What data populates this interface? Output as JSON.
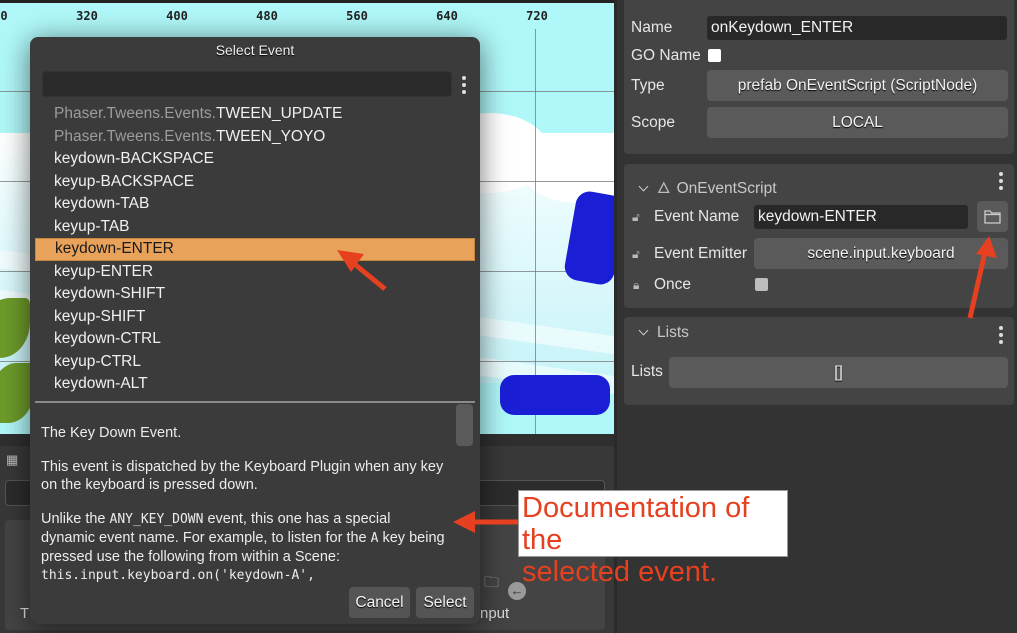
{
  "scene": {
    "ruler_ticks": [
      "0",
      "320",
      "400",
      "480",
      "560",
      "640",
      "720"
    ]
  },
  "bottom_panel": {
    "input_label": "nput",
    "t_label": "T"
  },
  "dialog": {
    "title": "Select Event",
    "filter_value": "",
    "events": [
      {
        "ns": "Phaser.Tweens.Events.",
        "name": "TWEEN_UPDATE",
        "selected": false
      },
      {
        "ns": "Phaser.Tweens.Events.",
        "name": "TWEEN_YOYO",
        "selected": false
      },
      {
        "ns": "",
        "name": "keydown-BACKSPACE",
        "selected": false
      },
      {
        "ns": "",
        "name": "keyup-BACKSPACE",
        "selected": false
      },
      {
        "ns": "",
        "name": "keydown-TAB",
        "selected": false
      },
      {
        "ns": "",
        "name": "keyup-TAB",
        "selected": false
      },
      {
        "ns": "",
        "name": "keydown-ENTER",
        "selected": true
      },
      {
        "ns": "",
        "name": "keyup-ENTER",
        "selected": false
      },
      {
        "ns": "",
        "name": "keydown-SHIFT",
        "selected": false
      },
      {
        "ns": "",
        "name": "keyup-SHIFT",
        "selected": false
      },
      {
        "ns": "",
        "name": "keydown-CTRL",
        "selected": false
      },
      {
        "ns": "",
        "name": "keyup-CTRL",
        "selected": false
      },
      {
        "ns": "",
        "name": "keydown-ALT",
        "selected": false
      }
    ],
    "doc": {
      "p1": "The Key Down Event.",
      "p2": "This event is dispatched by the Keyboard Plugin when any key on the keyboard is pressed down.",
      "p3_a": "Unlike the ",
      "p3_code1": "ANY_KEY_DOWN",
      "p3_b": " event, this one has a special dynamic event name. For example, to listen for the ",
      "p3_code2": "A",
      "p3_c": " key being pressed use the following from within a Scene: ",
      "p3_code3": "this.input.keyboard.on('keydown-A',"
    },
    "cancel_label": "Cancel",
    "select_label": "Select"
  },
  "inspector": {
    "name_label": "Name",
    "name_value": "onKeydown_ENTER",
    "go_name_label": "GO Name",
    "go_name_checked": false,
    "type_label": "Type",
    "type_value": "prefab OnEventScript (ScriptNode)",
    "scope_label": "Scope",
    "scope_value": "LOCAL",
    "script_section": {
      "title": "OnEventScript",
      "event_name_label": "Event Name",
      "event_name_value": "keydown-ENTER",
      "event_emitter_label": "Event Emitter",
      "event_emitter_value": "scene.input.keyboard",
      "once_label": "Once",
      "once_checked": false
    },
    "lists_section": {
      "title": "Lists",
      "lists_label": "Lists",
      "lists_value": "[]"
    }
  },
  "annotation": {
    "text_line1": "Documentation of the",
    "text_line2": "selected event.",
    "color": "#e5401f"
  }
}
